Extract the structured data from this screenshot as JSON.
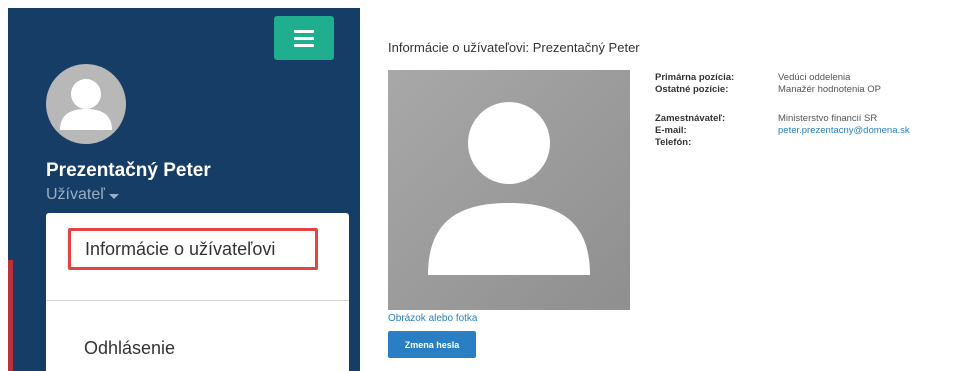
{
  "sidebar": {
    "user_name": "Prezentačný Peter",
    "user_role": "Užívateľ",
    "menu_icon": "hamburger-icon",
    "dropdown": {
      "item_info": "Informácie o užívateľovi",
      "item_logout": "Odhlásenie"
    }
  },
  "content": {
    "title": "Informácie o užívateľovi: Prezentačný Peter",
    "fields": {
      "primary_position_label": "Primárna pozícia:",
      "primary_position_value": "Vedúci oddelenia",
      "other_positions_label": "Ostatné pozície:",
      "other_positions_value": "Manažér hodnotenia OP",
      "employer_label": "Zamestnávateľ:",
      "employer_value": "Ministerstvo financií SR",
      "email_label": "E-mail:",
      "email_value": "peter.prezentacny@domena.sk",
      "phone_label": "Telefón:"
    },
    "photo_link": "Obrázok alebo fotka",
    "change_password_button": "Zmena hesla"
  },
  "colors": {
    "sidebar_bg": "#153d66",
    "menu_toggle": "#1fae8e",
    "highlight_border": "#e54343",
    "link": "#2a7fc4"
  }
}
